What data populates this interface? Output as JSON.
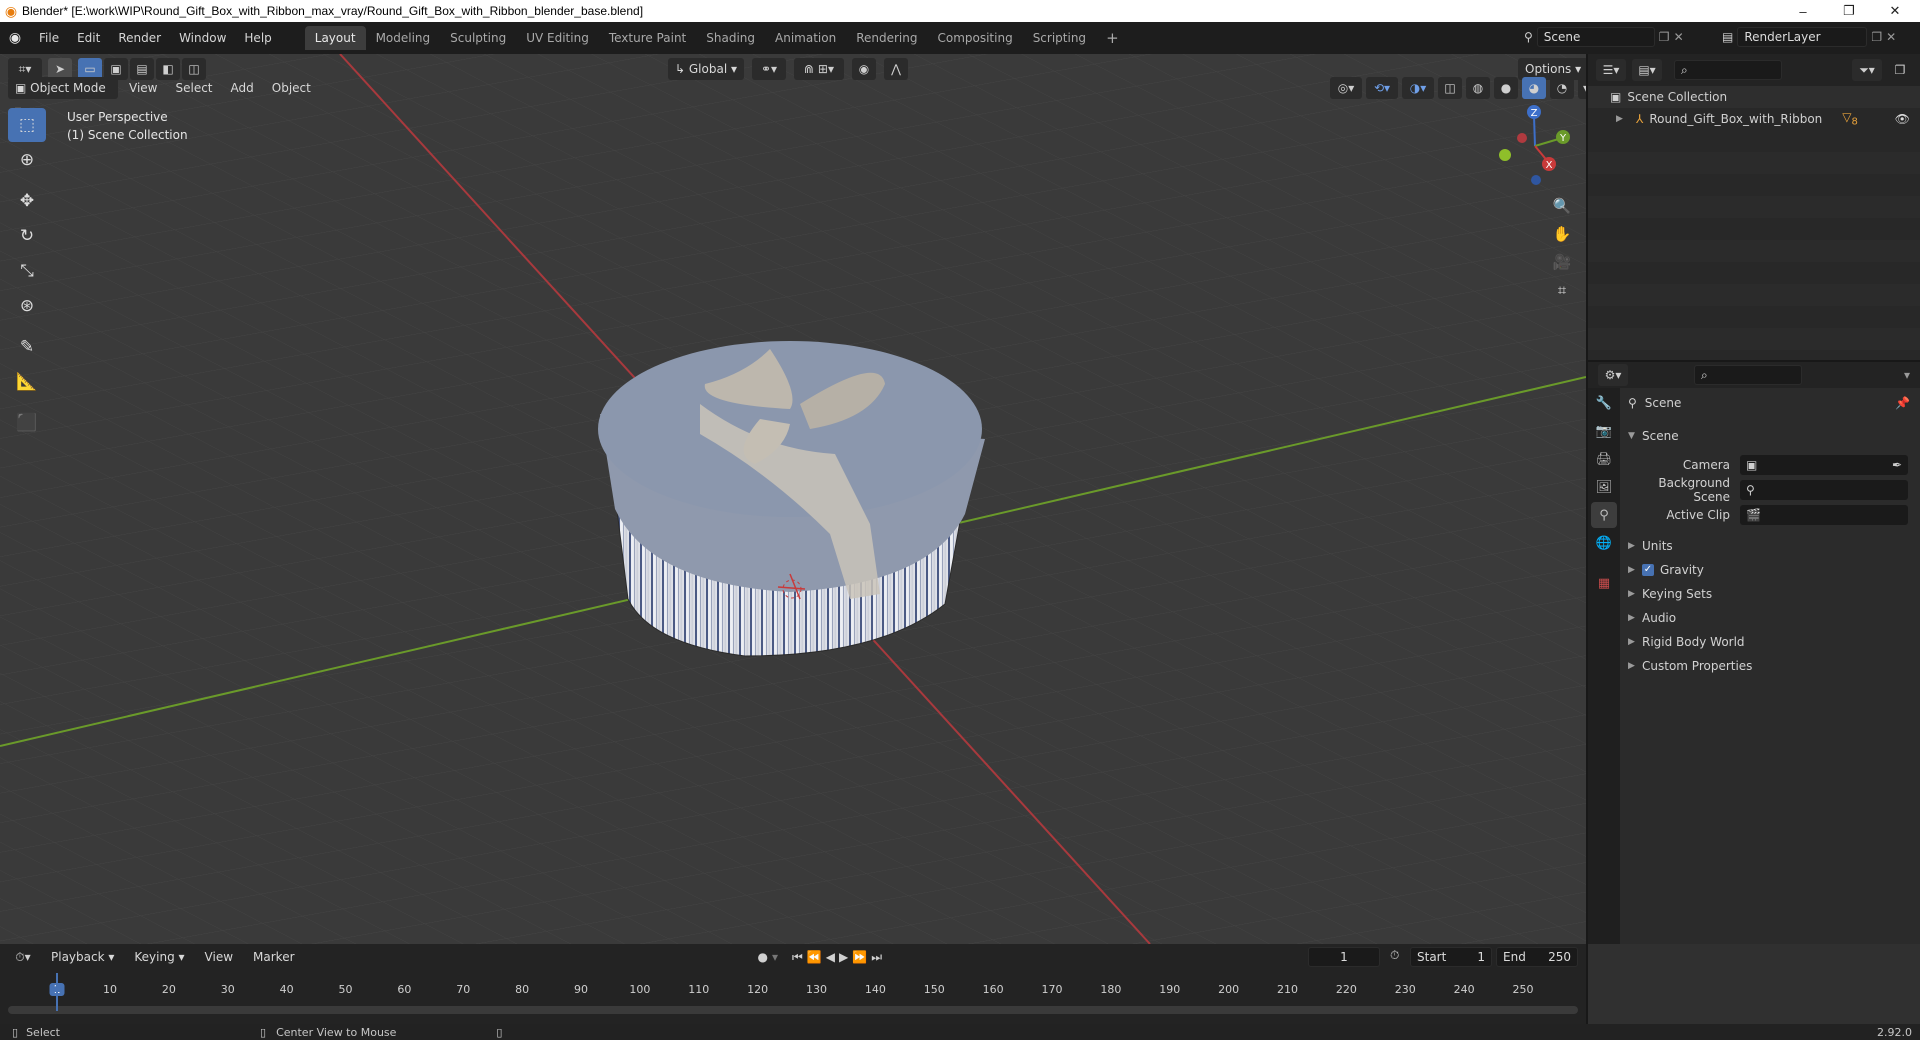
{
  "title_bar": {
    "title": "Blender* [E:\\work\\WIP\\Round_Gift_Box_with_Ribbon_max_vray/Round_Gift_Box_with_Ribbon_blender_base.blend]",
    "minimize": "–",
    "maximize": "❐",
    "close": "✕"
  },
  "menu": [
    "File",
    "Edit",
    "Render",
    "Window",
    "Help"
  ],
  "workspaces": [
    "Layout",
    "Modeling",
    "Sculpting",
    "UV Editing",
    "Texture Paint",
    "Shading",
    "Animation",
    "Rendering",
    "Compositing",
    "Scripting"
  ],
  "active_workspace": "Layout",
  "add_workspace": "+",
  "scene_selector": {
    "value": "Scene"
  },
  "view_layer": {
    "value": "RenderLayer"
  },
  "viewport": {
    "mode": "Object Mode",
    "menus": [
      "View",
      "Select",
      "Add",
      "Object"
    ],
    "orientation": "Global",
    "options_label": "Options",
    "perspective_label": "User Perspective",
    "collection_label": "(1) Scene Collection",
    "gizmo_axes": {
      "x": "X",
      "y": "Y",
      "z": "Z"
    },
    "colors": {
      "x_axis": "#a8393d",
      "y_axis": "#6a9a2a",
      "grid": "#474747",
      "background": "#3a3a3a",
      "lid": "#8b97ad",
      "stripe": "#4b5a84"
    }
  },
  "outliner": {
    "search_placeholder": "",
    "root": "Scene Collection",
    "items": [
      {
        "name": "Round_Gift_Box_with_Ribbon",
        "badge": "8"
      }
    ]
  },
  "properties": {
    "search_placeholder": "",
    "context": "Scene",
    "panel_title": "Scene",
    "fields": [
      {
        "label": "Camera",
        "value": ""
      },
      {
        "label": "Background Scene",
        "value": ""
      },
      {
        "label": "Active Clip",
        "value": ""
      }
    ],
    "subpanels": [
      "Units",
      "Gravity",
      "Keying Sets",
      "Audio",
      "Rigid Body World",
      "Custom Properties"
    ],
    "gravity_checked": true
  },
  "timeline": {
    "menus": [
      "Playback",
      "Keying",
      "View",
      "Marker"
    ],
    "current_frame": "1",
    "start_label": "Start",
    "start": "1",
    "end_label": "End",
    "end": "250",
    "ticks": [
      "1",
      "10",
      "20",
      "30",
      "40",
      "50",
      "60",
      "70",
      "80",
      "90",
      "100",
      "110",
      "120",
      "130",
      "140",
      "150",
      "160",
      "170",
      "180",
      "190",
      "200",
      "210",
      "220",
      "230",
      "240",
      "250"
    ]
  },
  "status_bar": {
    "select": "Select",
    "center_view": "Center View to Mouse",
    "version": "2.92.0"
  }
}
